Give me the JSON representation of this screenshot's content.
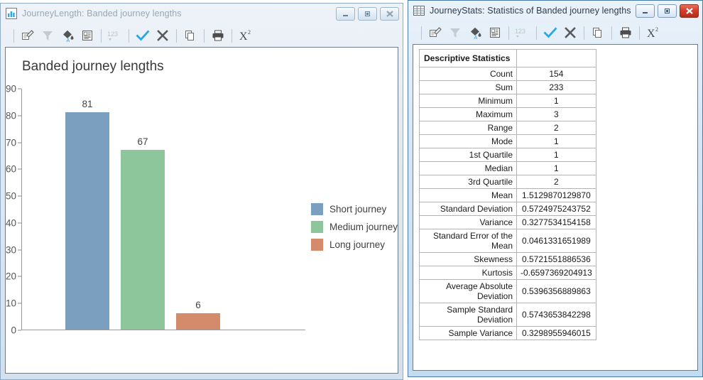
{
  "left_window": {
    "title": "JourneyLength: Banded journey lengths",
    "icon": "bar-chart-icon",
    "active": false,
    "buttons": {
      "minimize": "Minimize",
      "restore": "Restore",
      "close": "Close"
    },
    "toolbar": [
      {
        "name": "edit-icon",
        "label": "Edit"
      },
      {
        "name": "filter-icon",
        "label": "Filter"
      },
      {
        "name": "fill-color-icon",
        "label": "Fill Colour"
      },
      {
        "name": "annotate-icon",
        "label": "Annotate"
      },
      {
        "name": "number-format-icon",
        "label": "123"
      },
      {
        "name": "accept-icon",
        "label": "Accept"
      },
      {
        "name": "reject-icon",
        "label": "Reject"
      },
      {
        "name": "copy-icon",
        "label": "Copy"
      },
      {
        "name": "print-icon",
        "label": "Print"
      },
      {
        "name": "chi-square-icon",
        "label": "Chi-square"
      }
    ]
  },
  "right_window": {
    "title": "JourneyStats: Statistics of Banded journey lengths",
    "icon": "table-icon",
    "active": true,
    "buttons": {
      "minimize": "Minimize",
      "restore": "Restore",
      "close": "Close"
    },
    "toolbar": [
      {
        "name": "edit-icon",
        "label": "Edit"
      },
      {
        "name": "filter-icon",
        "label": "Filter"
      },
      {
        "name": "fill-color-icon",
        "label": "Fill Colour"
      },
      {
        "name": "annotate-icon",
        "label": "Annotate"
      },
      {
        "name": "number-format-icon",
        "label": "123"
      },
      {
        "name": "accept-icon",
        "label": "Accept"
      },
      {
        "name": "reject-icon",
        "label": "Reject"
      },
      {
        "name": "copy-icon",
        "label": "Copy"
      },
      {
        "name": "print-icon",
        "label": "Print"
      },
      {
        "name": "chi-square-icon",
        "label": "Chi-square"
      }
    ],
    "table": {
      "header": {
        "label": "Descriptive Statistics",
        "value": ""
      },
      "rows": [
        {
          "label": "Count",
          "value": "154"
        },
        {
          "label": "Sum",
          "value": "233"
        },
        {
          "label": "Minimum",
          "value": "1"
        },
        {
          "label": "Maximum",
          "value": "3"
        },
        {
          "label": "Range",
          "value": "2"
        },
        {
          "label": "Mode",
          "value": "1"
        },
        {
          "label": "1st Quartile",
          "value": "1"
        },
        {
          "label": "Median",
          "value": "1"
        },
        {
          "label": "3rd Quartile",
          "value": "2"
        },
        {
          "label": "Mean",
          "value": "1.5129870129870"
        },
        {
          "label": "Standard Deviation",
          "value": "0.5724975243752"
        },
        {
          "label": "Variance",
          "value": "0.3277534154158"
        },
        {
          "label": "Standard Error of the Mean",
          "value": "0.0461331651989"
        },
        {
          "label": "Skewness",
          "value": "0.5721551886536"
        },
        {
          "label": "Kurtosis",
          "value": "-0.6597369204913"
        },
        {
          "label": "Average Absolute Deviation",
          "value": "0.5396356889863"
        },
        {
          "label": "Sample Standard Deviation",
          "value": "0.5743653842298"
        },
        {
          "label": "Sample Variance",
          "value": "0.3298955946015"
        }
      ]
    }
  },
  "chart_data": {
    "type": "bar",
    "title": "Banded journey lengths",
    "xlabel": "",
    "ylabel": "",
    "categories": [
      "Short journey",
      "Medium journey",
      "Long journey"
    ],
    "values": [
      81,
      67,
      6
    ],
    "colors": [
      "#7ba0bf",
      "#8dc69a",
      "#d38b6c"
    ],
    "ylim": [
      0,
      90
    ],
    "yticks": [
      0,
      10,
      20,
      30,
      40,
      50,
      60,
      70,
      80,
      90
    ],
    "grid": false,
    "legend_position": "right",
    "legend": [
      {
        "label": "Short journey",
        "color": "#7ba0bf"
      },
      {
        "label": "Medium journey",
        "color": "#8dc69a"
      },
      {
        "label": "Long journey",
        "color": "#d38b6c"
      }
    ]
  },
  "theme": {
    "accent": "#29a8e0",
    "bar_blue": "#7ba0bf",
    "bar_green": "#8dc69a",
    "bar_orange": "#d38b6c",
    "close_red": "#c7402a"
  }
}
